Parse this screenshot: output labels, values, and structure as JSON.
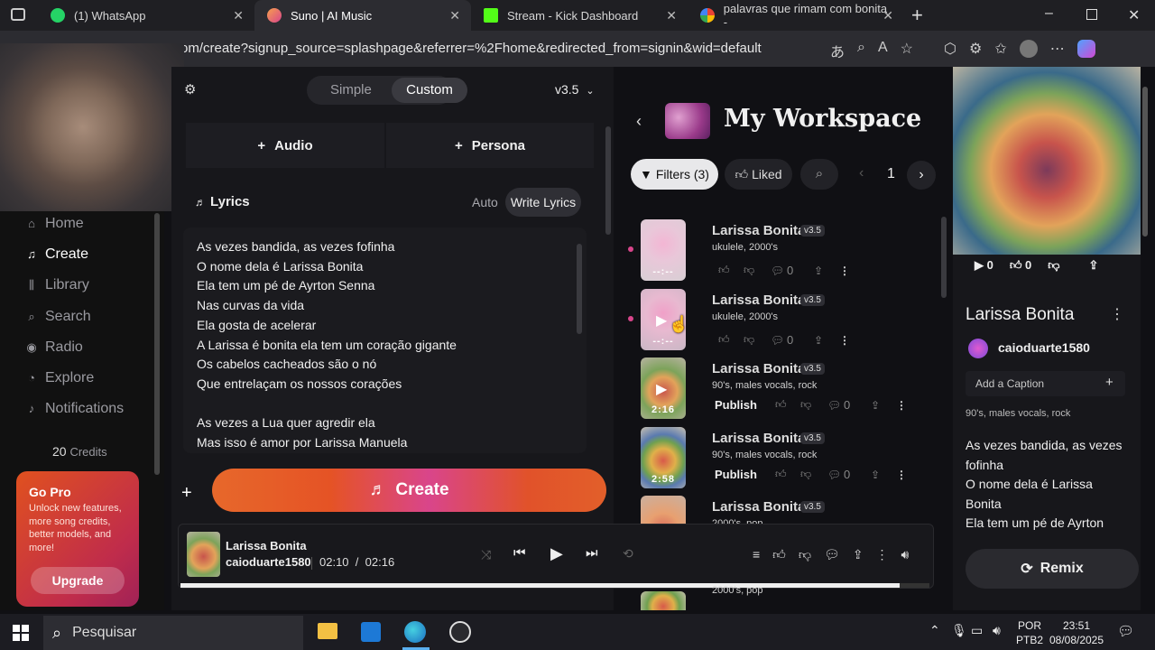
{
  "browser": {
    "tabs": [
      {
        "label": "(1) WhatsApp"
      },
      {
        "label": "Suno | AI Music"
      },
      {
        "label": "Stream - Kick Dashboard"
      },
      {
        "label": "palavras que rimam com bonita -"
      }
    ],
    "url": "om/create?signup_source=splashpage&referrer=%2Fhome&redirected_from=signin&wid=default"
  },
  "sidebar": {
    "items": [
      {
        "label": "Home"
      },
      {
        "label": "Create"
      },
      {
        "label": "Library"
      },
      {
        "label": "Search"
      },
      {
        "label": "Radio"
      },
      {
        "label": "Explore"
      },
      {
        "label": "Notifications"
      }
    ],
    "credits": "20",
    "credits_label": "Credits",
    "gopro_title": "Go Pro",
    "gopro_text": "Unlock new features, more song credits, better models, and more!",
    "upgrade": "Upgrade"
  },
  "create": {
    "mode_simple": "Simple",
    "mode_custom": "Custom",
    "version": "v3.5",
    "audio": "Audio",
    "persona": "Persona",
    "lyrics_label": "Lyrics",
    "auto": "Auto",
    "write_lyrics": "Write Lyrics",
    "lyrics_lines": [
      "As vezes bandida, as vezes fofinha",
      "O nome dela é Larissa Bonita",
      "Ela tem um pé de Ayrton Senna",
      "Nas curvas da vida",
      "Ela gosta de acelerar",
      "A Larissa é bonita ela tem um coração gigante",
      "Os cabelos cacheados são o nó",
      "Que entrelaçam os nossos corações",
      "",
      "As vezes a Lua quer agredir ela",
      "Mas isso é amor por Larissa Manuela"
    ],
    "create_button": "Create"
  },
  "workspace": {
    "title": "My Workspace",
    "filters": "Filters (3)",
    "liked": "Liked",
    "page": "1",
    "songs": [
      {
        "title": "Larissa Bonita",
        "version": "v3.5",
        "tags": "ukulele, 2000's",
        "comments": "0",
        "duration": "--:--",
        "publish": ""
      },
      {
        "title": "Larissa Bonita",
        "version": "v3.5",
        "tags": "ukulele, 2000's",
        "comments": "0",
        "duration": "--:--",
        "publish": ""
      },
      {
        "title": "Larissa Bonita",
        "version": "v3.5",
        "tags": "90's, males vocals, rock",
        "comments": "0",
        "duration": "2:16",
        "publish": "Publish"
      },
      {
        "title": "Larissa Bonita",
        "version": "v3.5",
        "tags": "90's, males vocals, rock",
        "comments": "0",
        "duration": "2:58",
        "publish": "Publish"
      },
      {
        "title": "Larissa Bonita",
        "version": "v3.5",
        "tags": "2000's, pop",
        "comments": "",
        "duration": "",
        "publish": ""
      }
    ],
    "partial_tag": "2000's, pop"
  },
  "detail": {
    "plays": "0",
    "likes": "0",
    "title": "Larissa Bonita",
    "user": "caioduarte1580",
    "caption_placeholder": "Add a Caption",
    "tags": "90's, males vocals, rock",
    "lyrics_lines": [
      "As vezes bandida, as vezes",
      "fofinha",
      "O nome dela é Larissa",
      "Bonita",
      "Ela tem um pé de Ayrton"
    ],
    "remix": "Remix"
  },
  "player": {
    "title": "Larissa Bonita",
    "user": "caioduarte1580",
    "current": "02:10",
    "separator": "/",
    "total": "02:16",
    "progress": 0.96
  },
  "taskbar": {
    "search_placeholder": "Pesquisar",
    "lang": "POR",
    "layout": "PTB2",
    "time": "23:51",
    "date": "08/08/2025"
  },
  "colors": {
    "accent_create": "#e8532a",
    "accent_pink": "#d9458b",
    "gopro": "#d43d3a"
  }
}
